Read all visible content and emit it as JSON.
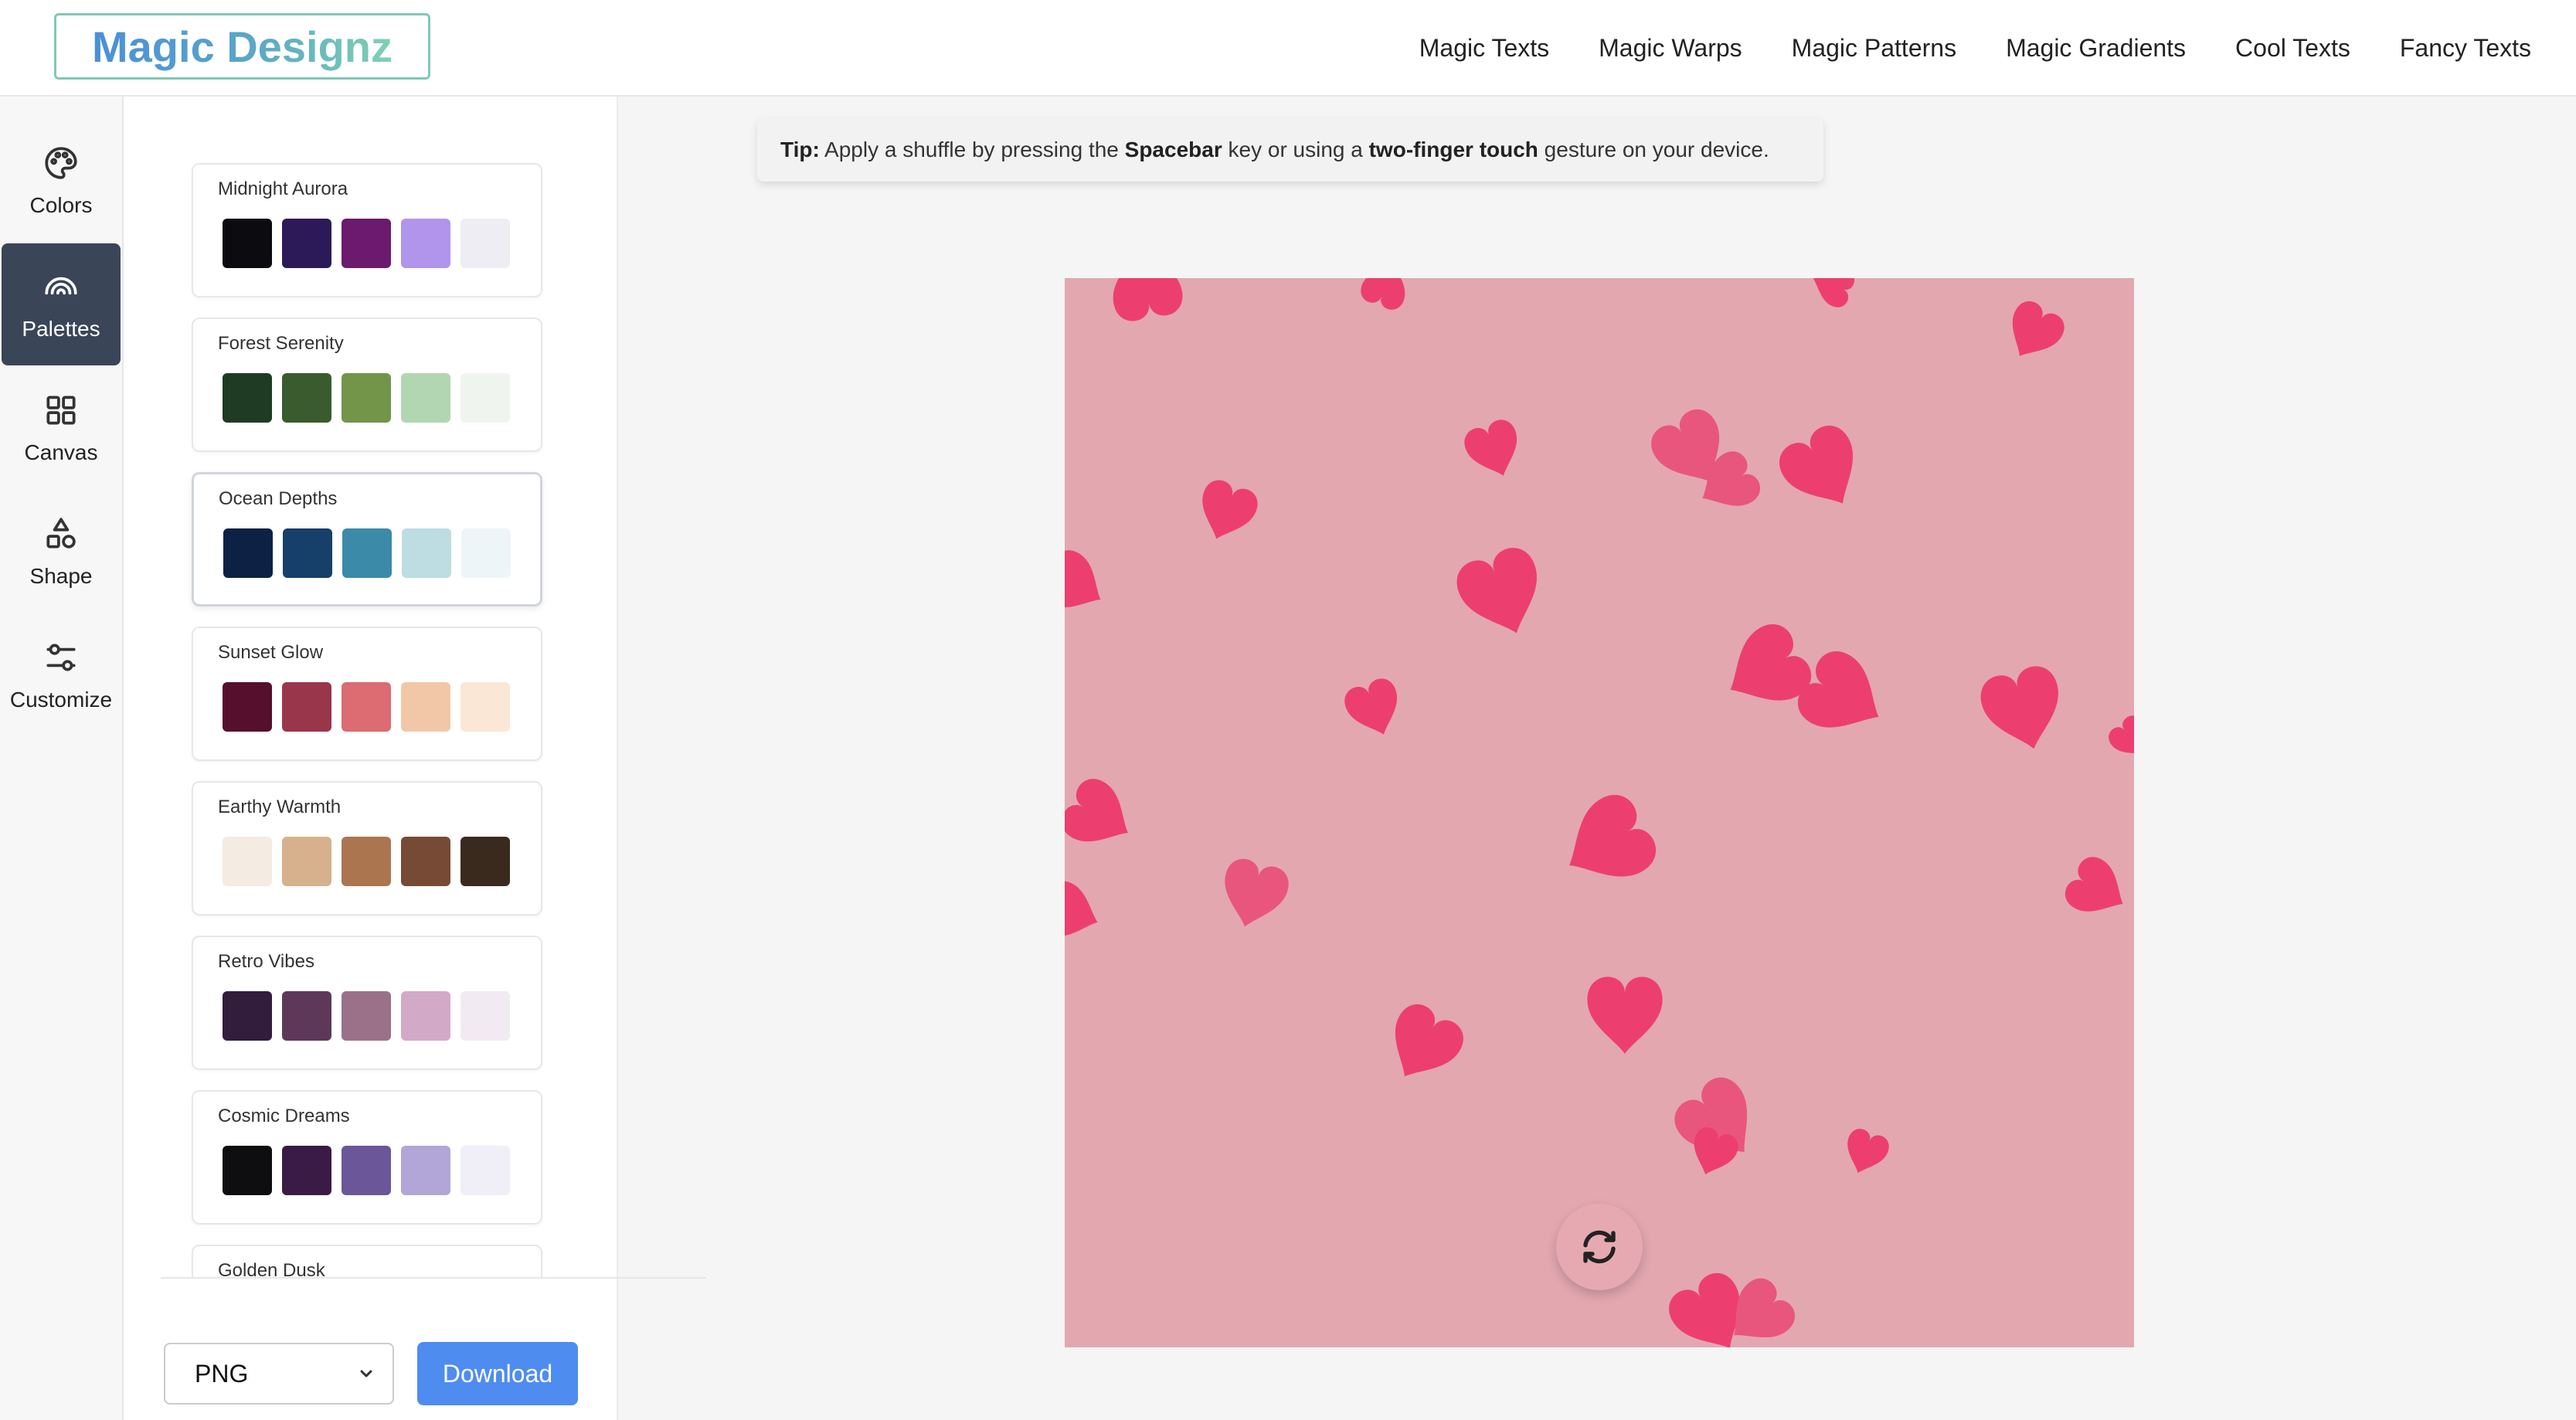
{
  "header": {
    "logo_text": "Magic Designz",
    "nav": [
      "Magic Texts",
      "Magic Warps",
      "Magic Patterns",
      "Magic Gradients",
      "Cool Texts",
      "Fancy Texts"
    ]
  },
  "rail": {
    "items": [
      {
        "label": "Colors",
        "icon": "palette-icon",
        "active": false
      },
      {
        "label": "Palettes",
        "icon": "rainbow-icon",
        "active": true
      },
      {
        "label": "Canvas",
        "icon": "grid-icon",
        "active": false
      },
      {
        "label": "Shape",
        "icon": "shapes-icon",
        "active": false
      },
      {
        "label": "Customize",
        "icon": "sliders-icon",
        "active": false
      }
    ]
  },
  "palettes": [
    {
      "name": "Midnight Aurora",
      "colors": [
        "#0b0b10",
        "#2c1a58",
        "#6b1a6e",
        "#b194ec",
        "#eeedf3"
      ]
    },
    {
      "name": "Forest Serenity",
      "colors": [
        "#1f3b24",
        "#3a5b2e",
        "#72954a",
        "#b1d6b1",
        "#eff5ee"
      ]
    },
    {
      "name": "Ocean Depths",
      "colors": [
        "#0c2143",
        "#163f6a",
        "#3a8aa8",
        "#bddde2",
        "#eef5f8"
      ],
      "selected": true
    },
    {
      "name": "Sunset Glow",
      "colors": [
        "#560f2c",
        "#9a364c",
        "#dc6b72",
        "#f2c7a7",
        "#fbe7d6"
      ]
    },
    {
      "name": "Earthy Warmth",
      "colors": [
        "#f4ebe3",
        "#d7b18d",
        "#ab7550",
        "#774a35",
        "#3a2a1d"
      ]
    },
    {
      "name": "Retro Vibes",
      "colors": [
        "#321d3c",
        "#5e3859",
        "#9a7189",
        "#d2aac8",
        "#f2eaf2"
      ]
    },
    {
      "name": "Cosmic Dreams",
      "colors": [
        "#0e0e10",
        "#3a1b45",
        "#6a5699",
        "#b1a6d7",
        "#f0eef7"
      ]
    },
    {
      "name": "Golden Dusk",
      "colors": []
    }
  ],
  "export": {
    "format": "PNG",
    "download_label": "Download"
  },
  "tip": {
    "lead": "Tip:",
    "text1": " Apply a shuffle by pressing the ",
    "key": "Spacebar",
    "text2": " key or using a ",
    "gesture": "two-finger touch",
    "text3": " gesture on your device."
  },
  "canvas": {
    "background": "#e3a7b0",
    "heart_color": "#ec3f6f",
    "heart_color_light": "#e8567e"
  }
}
